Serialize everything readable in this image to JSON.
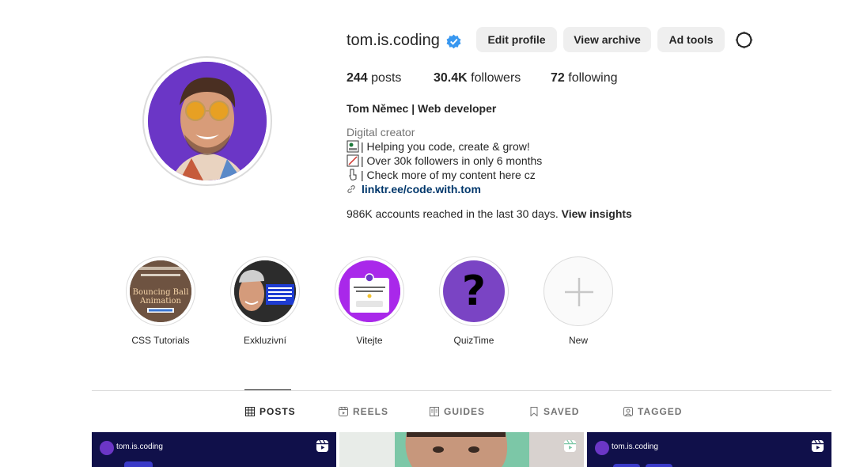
{
  "profile": {
    "username": "tom.is.coding",
    "edit_profile": "Edit profile",
    "view_archive": "View archive",
    "ad_tools": "Ad tools",
    "posts_count": "244",
    "posts_label": " posts",
    "followers_count": "30.4K",
    "followers_label": " followers",
    "following_count": "72",
    "following_label": " following",
    "full_name": "Tom Němec | Web developer",
    "category": "Digital creator",
    "bio_lines": [
      "| Helping you code, create & grow!",
      "| Over 30k followers in only 6 months",
      "| Check more of my content here cz"
    ],
    "link": "linktr.ee/code.with.tom",
    "insights_text": "986K accounts reached in the last 30 days. ",
    "insights_link": "View insights"
  },
  "highlights": [
    {
      "label": "CSS Tutorials",
      "thumb_lines": [
        "Bouncing Ball",
        "Animation"
      ]
    },
    {
      "label": "Exkluzivní"
    },
    {
      "label": "Vitejte"
    },
    {
      "label": "QuizTime",
      "thumb_glyph": "?"
    },
    {
      "label": "New"
    }
  ],
  "tabs": [
    {
      "label": "POSTS",
      "icon": "grid-icon",
      "active": true
    },
    {
      "label": "REELS",
      "icon": "reels-icon"
    },
    {
      "label": "GUIDES",
      "icon": "guides-icon"
    },
    {
      "label": "SAVED",
      "icon": "bookmark-icon"
    },
    {
      "label": "TAGGED",
      "icon": "tagged-icon"
    }
  ],
  "posts": [
    {
      "author": "tom.is.coding"
    },
    {},
    {
      "author": "tom.is.coding"
    }
  ],
  "colors": {
    "verified": "#3897f0",
    "link": "#00376b",
    "post_bg": "#10104a",
    "avatar_bg": "#6b36c6"
  }
}
